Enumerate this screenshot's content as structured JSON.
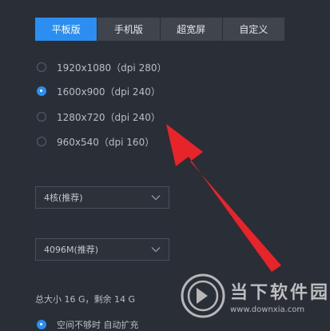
{
  "tabs": [
    {
      "label": "平板版",
      "active": true
    },
    {
      "label": "手机版",
      "active": false
    },
    {
      "label": "超宽屏",
      "active": false
    },
    {
      "label": "自定义",
      "active": false
    }
  ],
  "resolutions": [
    {
      "label": "1920x1080（dpi 280）",
      "checked": false
    },
    {
      "label": "1600x900（dpi 240）",
      "checked": true
    },
    {
      "label": "1280x720（dpi 240）",
      "checked": false
    },
    {
      "label": "960x540（dpi 160）",
      "checked": false
    }
  ],
  "cpu_select": {
    "value": "4核(推荐)"
  },
  "memory_select": {
    "value": "4096M(推荐)"
  },
  "storage": {
    "summary": "总大小 16 G，剩余 14 G"
  },
  "storage_option": {
    "label": "空间不够时 自动扩充",
    "checked": true
  },
  "watermark": {
    "name": "当下软件园",
    "url": "www.downxia.com"
  },
  "colors": {
    "accent": "#2b8ef0",
    "background": "#2a2e36",
    "arrow": "#e8242b"
  }
}
